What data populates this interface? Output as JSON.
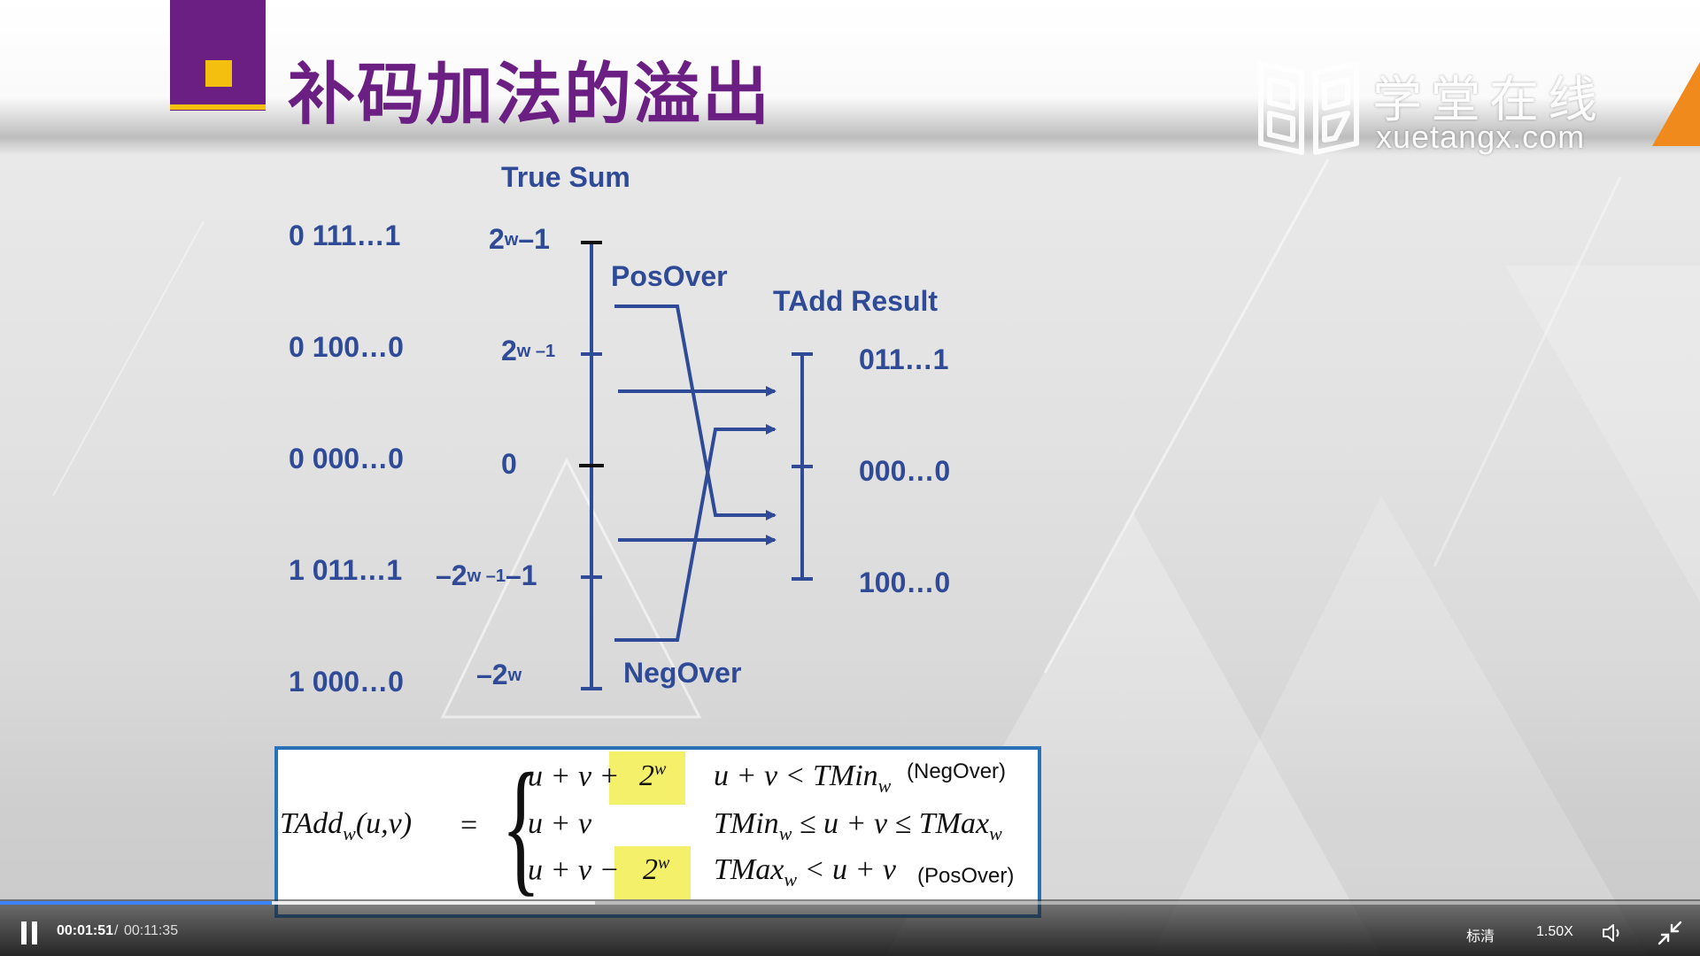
{
  "slide": {
    "title": "补码加法的溢出",
    "watermark_cn": "学堂在线",
    "watermark_en": "xuetangx.com"
  },
  "diagram": {
    "true_sum_label": "True Sum",
    "tadd_result_label": "TAdd Result",
    "posover_label": "PosOver",
    "negover_label": "NegOver",
    "binary_labels": [
      "0 111…1",
      "0 100…0",
      "0 000…0",
      "1 011…1",
      "1 000…0"
    ],
    "value_labels": [
      {
        "base": "2",
        "sup": "w",
        "rest": "–1"
      },
      {
        "base": "2",
        "sup": "w –1",
        "rest": ""
      },
      {
        "base": "0",
        "sup": "",
        "rest": ""
      },
      {
        "base": "–2",
        "sup": "w –1",
        "rest": "–1"
      },
      {
        "base": "–2",
        "sup": "w",
        "rest": ""
      }
    ],
    "result_labels": [
      "011…1",
      "000…0",
      "100…0"
    ]
  },
  "formula": {
    "lhs": "TAdd",
    "lhs_sub": "w",
    "lhs_args": "(u,v)",
    "equals": "=",
    "rows": [
      {
        "expr": "u + v +",
        "hl": "2",
        "hl_sup": "w",
        "cond_pre": "u + v < TMin",
        "cond_sub": "w",
        "cond_post": "",
        "note": "(NegOver)"
      },
      {
        "expr": "u + v",
        "hl": "",
        "hl_sup": "",
        "cond_pre": "TMin",
        "cond_sub": "w",
        "cond_post": " ≤ u + v ≤ TMax",
        "cond_sub2": "w",
        "note": ""
      },
      {
        "expr": "u + v −",
        "hl": "2",
        "hl_sup": "w",
        "cond_pre": "TMax",
        "cond_sub": "w",
        "cond_post": " < u + v",
        "note": "(PosOver)"
      }
    ],
    "highlight_color": "#f5f06a"
  },
  "player": {
    "current_time": "00:01:51",
    "separator": "/",
    "total_time": "00:11:35",
    "progress_fraction": 0.16,
    "quality_label": "标清",
    "speed_label": "1.50X",
    "accent_color": "#3b82f6",
    "icons": [
      "pause-icon",
      "volume-icon",
      "exit-fullscreen-icon"
    ]
  }
}
